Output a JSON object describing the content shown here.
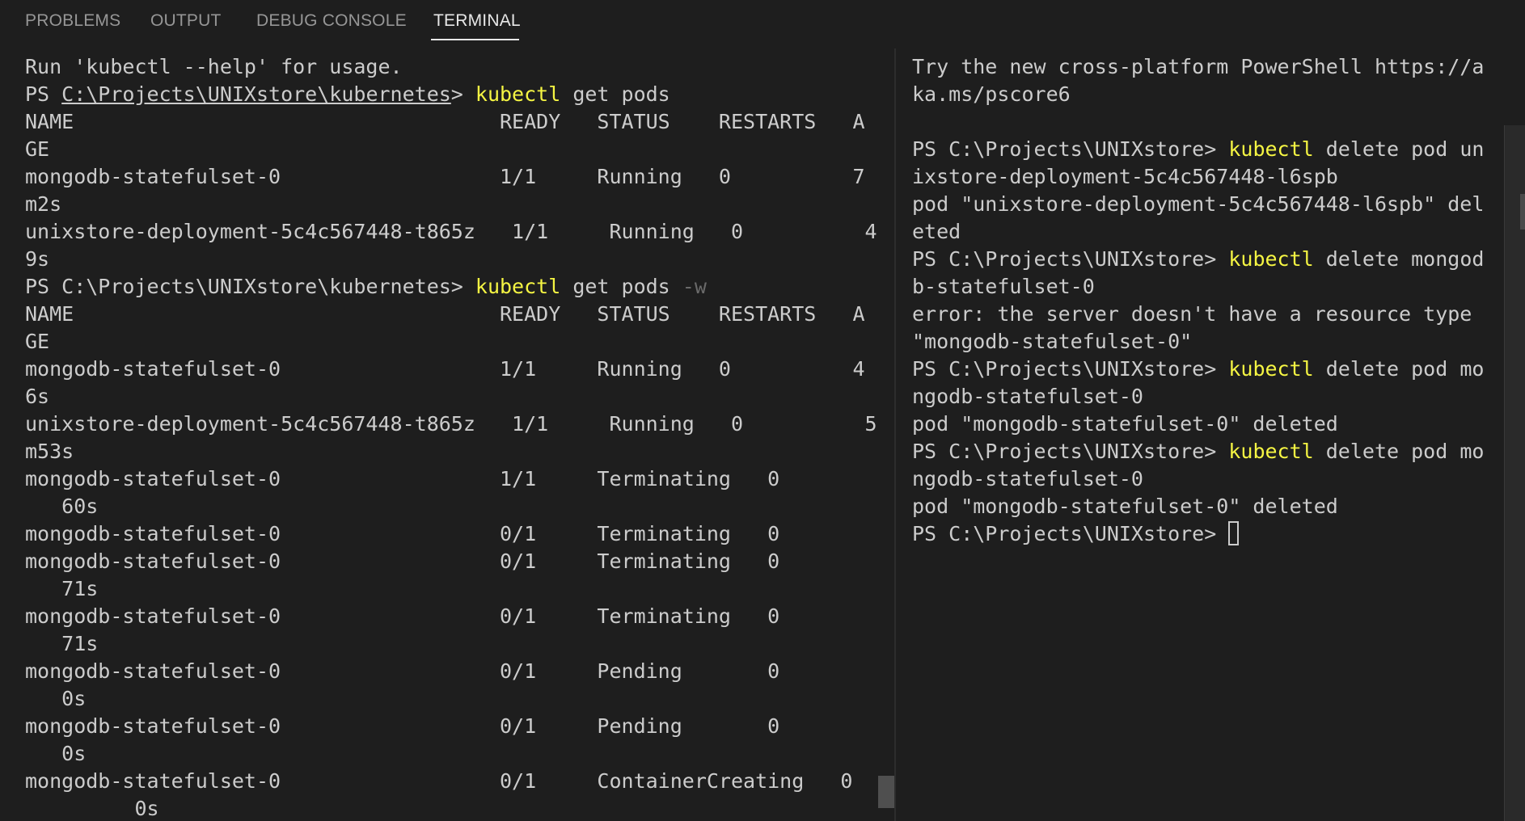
{
  "tabs": {
    "problems": "PROBLEMS",
    "output": "OUTPUT",
    "debug_console": "DEBUG CONSOLE",
    "terminal": "TERMINAL"
  },
  "left_terminal": {
    "lines": [
      "Run 'kubectl --help' for usage.",
      {
        "prompt": "PS ",
        "path": "C:\\Projects\\UNIXstore\\kubernetes",
        "gt": "> ",
        "cmd": "kubectl",
        "args": " get pods",
        "flag": ""
      },
      "NAME                                   READY   STATUS    RESTARTS   A",
      "GE",
      "mongodb-statefulset-0                  1/1     Running   0          7",
      "m2s",
      "unixstore-deployment-5c4c567448-t865z   1/1     Running   0          4",
      "9s",
      {
        "prompt": "PS ",
        "path": "C:\\Projects\\UNIXstore\\kubernetes",
        "gt": "> ",
        "cmd": "kubectl",
        "args": " get pods ",
        "flag": "-w",
        "plain_path": true
      },
      "NAME                                   READY   STATUS    RESTARTS   A",
      "GE",
      "mongodb-statefulset-0                  1/1     Running   0          4",
      "6s",
      "unixstore-deployment-5c4c567448-t865z   1/1     Running   0          5",
      "m53s",
      "mongodb-statefulset-0                  1/1     Terminating   0",
      "   60s",
      "mongodb-statefulset-0                  0/1     Terminating   0",
      "mongodb-statefulset-0                  0/1     Terminating   0",
      "   71s",
      "mongodb-statefulset-0                  0/1     Terminating   0",
      "   71s",
      "mongodb-statefulset-0                  0/1     Pending       0",
      "   0s",
      "mongodb-statefulset-0                  0/1     Pending       0",
      "   0s",
      "mongodb-statefulset-0                  0/1     ContainerCreating   0",
      "         0s"
    ]
  },
  "right_terminal": {
    "lines": [
      "Try the new cross-platform PowerShell https://a",
      "ka.ms/pscore6",
      "",
      {
        "prompt": "PS C:\\Projects\\UNIXstore> ",
        "cmd": "kubectl",
        "args": " delete pod un"
      },
      "ixstore-deployment-5c4c567448-l6spb",
      "pod \"unixstore-deployment-5c4c567448-l6spb\" del",
      "eted",
      {
        "prompt": "PS C:\\Projects\\UNIXstore> ",
        "cmd": "kubectl",
        "args": " delete mongod"
      },
      "b-statefulset-0",
      "error: the server doesn't have a resource type",
      "\"mongodb-statefulset-0\"",
      {
        "prompt": "PS C:\\Projects\\UNIXstore> ",
        "cmd": "kubectl",
        "args": " delete pod mo"
      },
      "ngodb-statefulset-0",
      "pod \"mongodb-statefulset-0\" deleted",
      {
        "prompt": "PS C:\\Projects\\UNIXstore> ",
        "cmd": "kubectl",
        "args": " delete pod mo"
      },
      "ngodb-statefulset-0",
      "pod \"mongodb-statefulset-0\" deleted",
      {
        "prompt": "PS C:\\Projects\\UNIXstore> ",
        "cmd": "",
        "args": "",
        "cursor": true
      }
    ]
  }
}
